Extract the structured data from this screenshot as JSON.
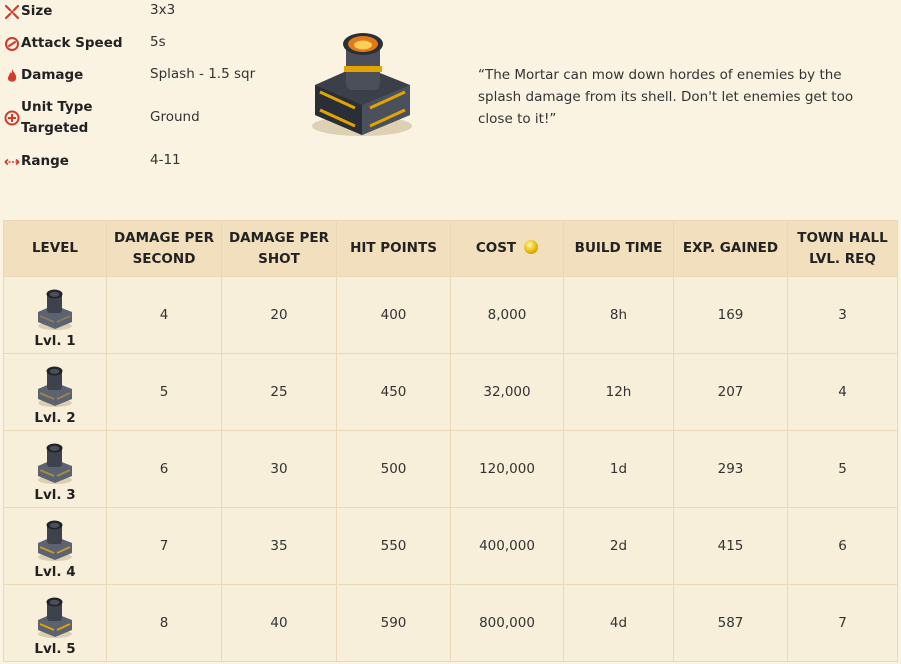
{
  "stats": [
    {
      "label": "Size",
      "value": "3x3",
      "icon": "size-icon"
    },
    {
      "label": "Attack Speed",
      "value": "5s",
      "icon": "attack-speed-icon"
    },
    {
      "label": "Damage",
      "value": "Splash - 1.5 sqr",
      "icon": "damage-flame-icon"
    },
    {
      "label": "Unit Type Targeted",
      "label_line1": "Unit Type",
      "label_line2": "Targeted",
      "value": "Ground",
      "icon": "target-icon"
    },
    {
      "label": "Range",
      "value": "4-11",
      "icon": "range-icon"
    }
  ],
  "quote": "“The Mortar can mow down hordes of enemies by the splash damage from its shell. Don't let enemies get too close to it!”",
  "colors": {
    "accent_red": "#d23a2a",
    "header_bg": "#f1dfbd",
    "row_bg": "#f8efdb",
    "page_bg": "#faf3e2"
  },
  "table": {
    "headers": {
      "level": "LEVEL",
      "dps_1": "DAMAGE PER",
      "dps_2": "SECOND",
      "dpshot_1": "DAMAGE PER",
      "dpshot_2": "SHOT",
      "hp": "HIT POINTS",
      "cost": "COST",
      "build": "BUILD TIME",
      "exp": "EXP. GAINED",
      "th_1": "TOWN HALL",
      "th_2": "LVL. REQ"
    },
    "rows": [
      {
        "level": "Lvl. 1",
        "dps": "4",
        "dpshot": "20",
        "hp": "400",
        "cost": "8,000",
        "build": "8h",
        "exp": "169",
        "th": "3"
      },
      {
        "level": "Lvl. 2",
        "dps": "5",
        "dpshot": "25",
        "hp": "450",
        "cost": "32,000",
        "build": "12h",
        "exp": "207",
        "th": "4"
      },
      {
        "level": "Lvl. 3",
        "dps": "6",
        "dpshot": "30",
        "hp": "500",
        "cost": "120,000",
        "build": "1d",
        "exp": "293",
        "th": "5"
      },
      {
        "level": "Lvl. 4",
        "dps": "7",
        "dpshot": "35",
        "hp": "550",
        "cost": "400,000",
        "build": "2d",
        "exp": "415",
        "th": "6"
      },
      {
        "level": "Lvl. 5",
        "dps": "8",
        "dpshot": "40",
        "hp": "590",
        "cost": "800,000",
        "build": "4d",
        "exp": "587",
        "th": "7"
      }
    ]
  }
}
